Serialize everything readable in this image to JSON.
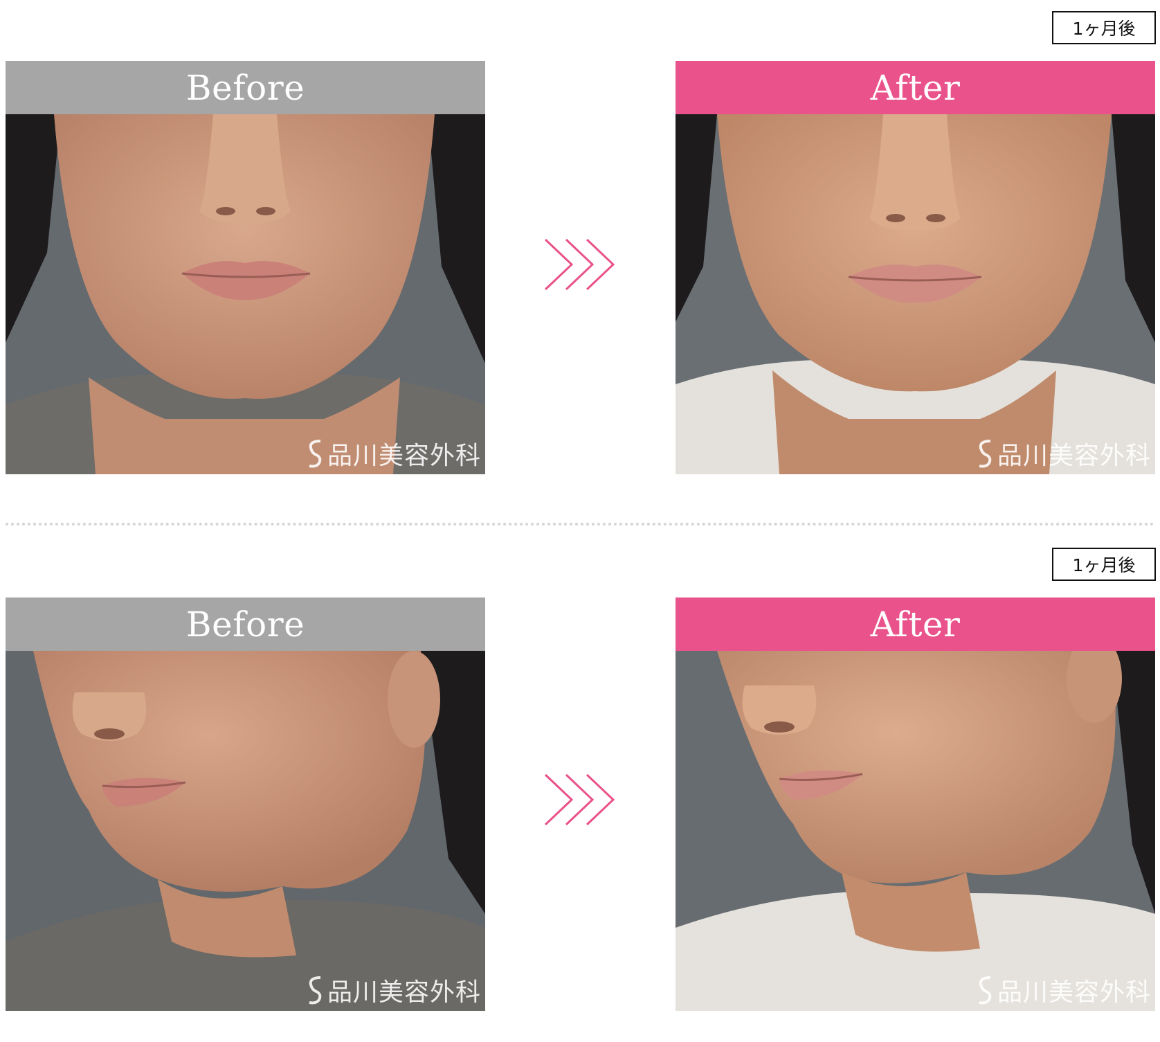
{
  "sections": [
    {
      "period": "1ヶ月後",
      "before_label": "Before",
      "after_label": "After",
      "watermark": "品川美容外科",
      "view": "front"
    },
    {
      "period": "1ヶ月後",
      "before_label": "Before",
      "after_label": "After",
      "watermark": "品川美容外科",
      "view": "oblique"
    }
  ],
  "colors": {
    "before_header": "#a6a6a6",
    "after_header": "#e9528a",
    "arrow": "#e9528a",
    "backdrop": "#6b7074"
  },
  "icons": {
    "arrow": "triple-chevron-right-icon",
    "logo": "brand-s-logo-icon"
  }
}
